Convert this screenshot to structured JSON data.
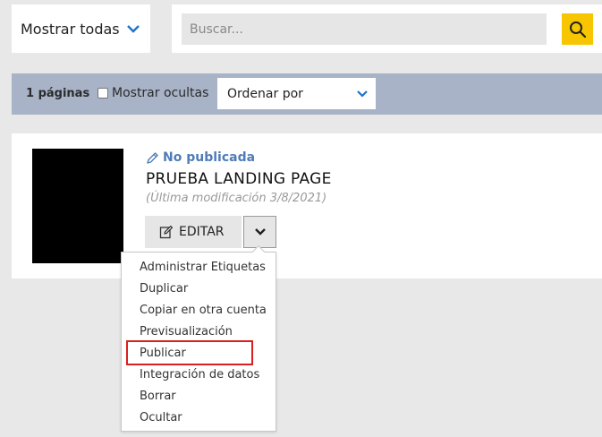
{
  "filter": {
    "label": "Mostrar todas"
  },
  "search": {
    "placeholder": "Buscar..."
  },
  "toolbar": {
    "page_count": "1 páginas",
    "show_hidden_label": "Mostrar ocultas",
    "sort_label": "Ordenar por"
  },
  "card": {
    "status": "No publicada",
    "title": "PRUEBA LANDING PAGE",
    "modified": "(Última modificación 3/8/2021)",
    "edit_label": "EDITAR"
  },
  "menu": {
    "items": [
      "Administrar Etiquetas",
      "Duplicar",
      "Copiar en otra cuenta",
      "Previsualización",
      "Publicar",
      "Integración de datos",
      "Borrar",
      "Ocultar"
    ],
    "highlighted": "Publicar"
  },
  "colors": {
    "accent_yellow": "#f7c600",
    "toolbar_bg": "#a8b3c7",
    "status_blue": "#4f7cb8",
    "chevron_blue": "#1f73c8",
    "highlight_red": "#d92020"
  }
}
